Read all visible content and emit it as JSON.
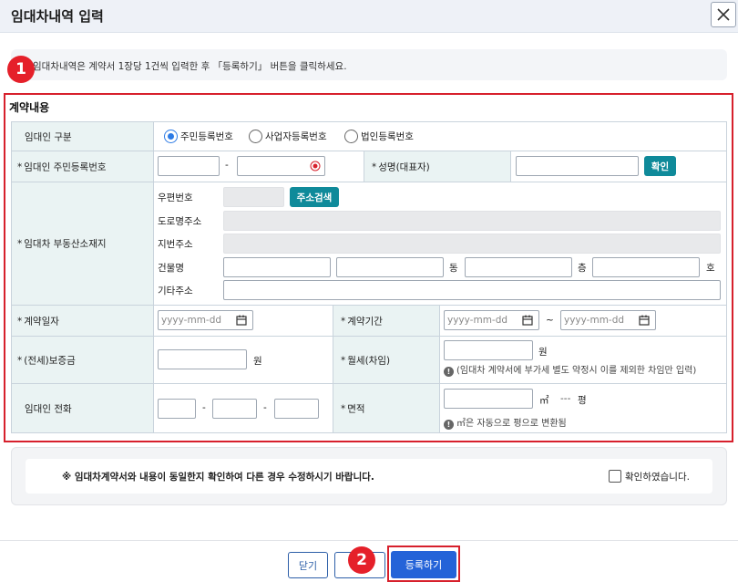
{
  "dialog": {
    "title": "임대차내역 입력"
  },
  "notice": {
    "text": "임대차내역은 계약서 1장당 1건씩 입력한 후 「등록하기」 버튼을 클릭하세요."
  },
  "markers": {
    "one": "1",
    "two": "2"
  },
  "section": {
    "title": "계약내용"
  },
  "form": {
    "lessor_type": {
      "label": "임대인 구분",
      "options": [
        "주민등록번호",
        "사업자등록번호",
        "법인등록번호"
      ],
      "selected": "주민등록번호"
    },
    "resident_no": {
      "label": "임대인 주민등록번호",
      "separator": "-"
    },
    "name": {
      "label": "성명(대표자)",
      "button": "확인"
    },
    "address": {
      "label": "임대차 부동산소재지",
      "zip_label": "우편번호",
      "search_button": "주소검색",
      "road_label": "도로명주소",
      "lot_label": "지번주소",
      "building_label": "건물명",
      "dong_unit": "동",
      "floor_unit": "층",
      "ho_unit": "호",
      "etc_label": "기타주소"
    },
    "contract_date": {
      "label": "계약일자",
      "placeholder": "yyyy-mm-dd"
    },
    "contract_period": {
      "label": "계약기간",
      "placeholder_start": "yyyy-mm-dd",
      "tilde": "~",
      "placeholder_end": "yyyy-mm-dd"
    },
    "deposit": {
      "label": "(전세)보증금",
      "unit": "원"
    },
    "monthly_rent": {
      "label": "월세(차임)",
      "unit": "원",
      "note": "(임대차 계약서에 부가세 별도 약정시 이를 제외한 차임만 입력)"
    },
    "phone": {
      "label": "임대인 전화",
      "separator": "-"
    },
    "area": {
      "label": "면적",
      "unit": "㎡",
      "pyeong_value": "---",
      "pyeong_unit": "평",
      "note": "㎡은 자동으로 평으로 변환됨"
    }
  },
  "confirm": {
    "message": "※ 임대차계약서와 내용이 동일한지 확인하여 다른 경우 수정하시기 바랍니다.",
    "checkbox_label": "확인하였습니다."
  },
  "footer": {
    "close_label": "닫기",
    "register_label": "등록하기"
  }
}
